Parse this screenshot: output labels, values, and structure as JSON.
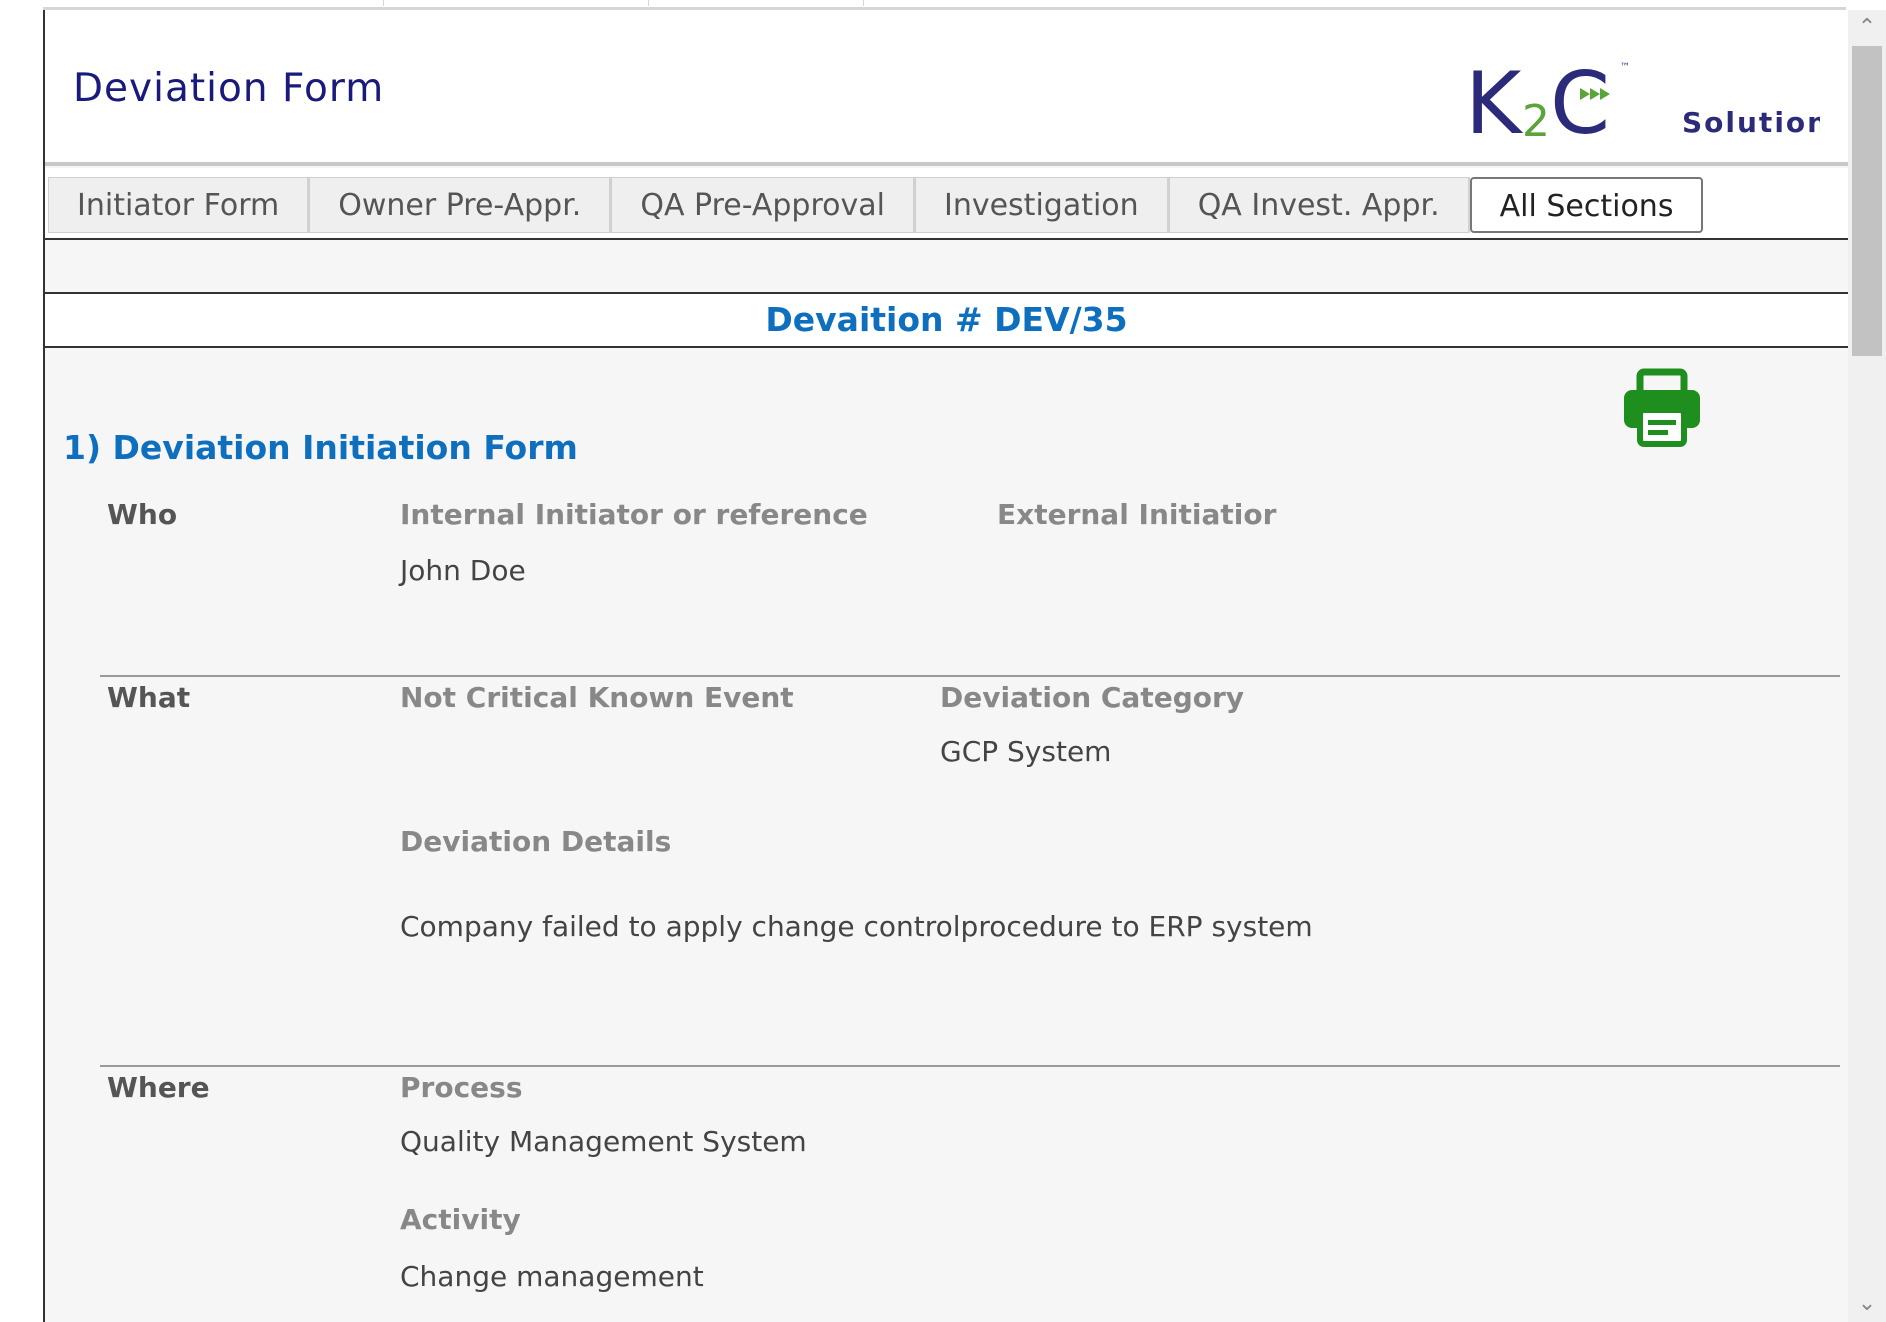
{
  "header": {
    "title": "Deviation Form",
    "logo_text": "K2C",
    "logo_sub": "Solutions",
    "logo_tm": "™"
  },
  "tabs": [
    {
      "label": "Initiator Form",
      "active": false
    },
    {
      "label": "Owner Pre-Appr.",
      "active": false
    },
    {
      "label": "QA Pre-Approval",
      "active": false
    },
    {
      "label": "Investigation",
      "active": false
    },
    {
      "label": "QA Invest. Appr.",
      "active": false
    },
    {
      "label": "All Sections",
      "active": true
    }
  ],
  "deviation": {
    "number_title": "Devaition # DEV/35"
  },
  "section": {
    "heading": "1) Deviation Initiation Form",
    "who": {
      "label": "Who",
      "internal_label": "Internal Initiator or reference",
      "internal_value": "John Doe",
      "external_label": "External Initiatior"
    },
    "what": {
      "label": "What",
      "event_label": "Not Critical Known Event",
      "category_label": "Deviation Category",
      "category_value": "GCP System",
      "details_label": "Deviation Details",
      "details_value": "Company failed to apply change controlprocedure to ERP system"
    },
    "where": {
      "label": "Where",
      "process_label": "Process",
      "process_value": "Quality Management System",
      "activity_label": "Activity",
      "activity_value": "Change management"
    }
  },
  "colors": {
    "title": "#1a1a7a",
    "accent": "#0d6fbe",
    "print_icon": "#1e8f1e",
    "logo_blue": "#2b2b7a",
    "logo_green": "#5aa43a"
  },
  "icons": {
    "print": "printer-icon",
    "scroll_up": "chevron-up-icon",
    "scroll_down": "chevron-down-icon"
  }
}
